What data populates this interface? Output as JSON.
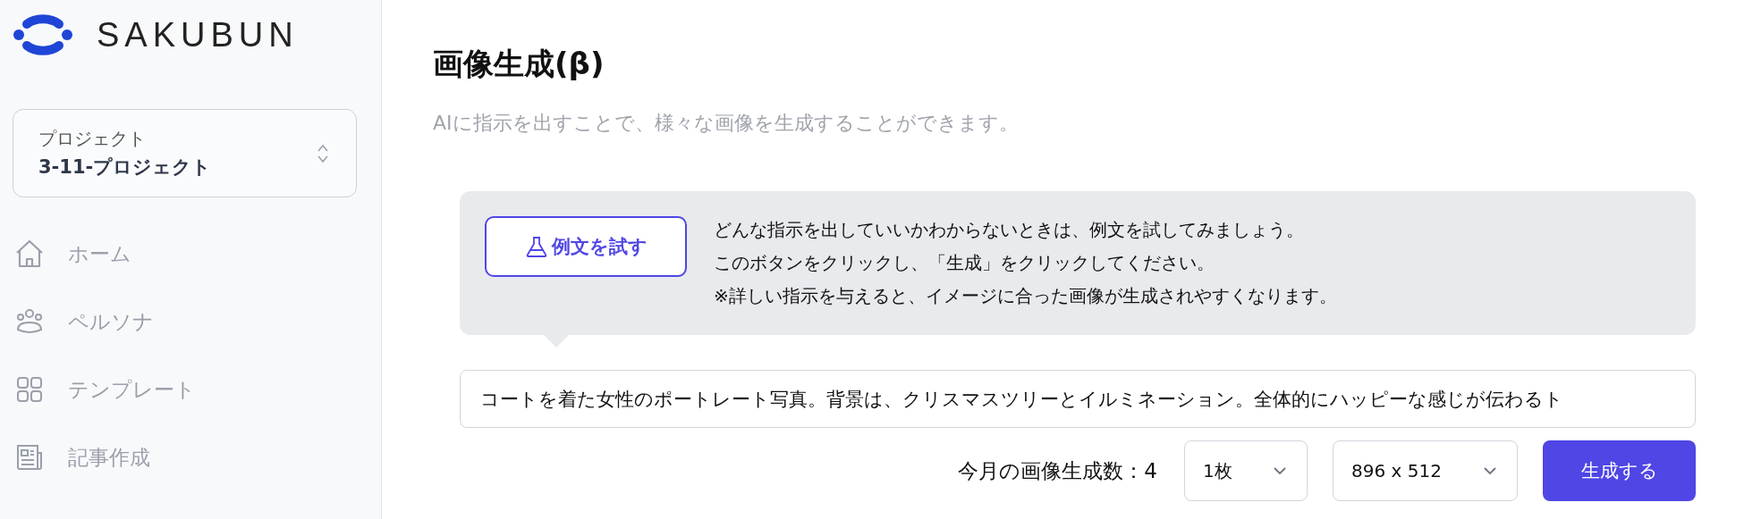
{
  "brand": "SAKUBUN",
  "project": {
    "label": "プロジェクト",
    "value": "3-11-プロジェクト"
  },
  "nav": [
    {
      "label": "ホーム",
      "kind": "home",
      "selected": false
    },
    {
      "label": "ペルソナ",
      "kind": "people",
      "selected": false
    },
    {
      "label": "テンプレート",
      "kind": "grid",
      "selected": false
    },
    {
      "label": "記事作成",
      "kind": "article",
      "selected": false
    }
  ],
  "page": {
    "title": "画像生成(β)",
    "subtitle": "AIに指示を出すことで、様々な画像を生成することができます。"
  },
  "tip": {
    "button": "例文を試す",
    "lines": [
      "どんな指示を出していいかわからないときは、例文を試してみましょう。",
      "このボタンをクリックし、「生成」をクリックしてください。",
      "※詳しい指示を与えると、イメージに合った画像が生成されやすくなります。"
    ]
  },
  "prompt": {
    "value": "コートを着た女性のポートレート写真。背景は、クリスマスツリーとイルミネーション。全体的にハッピーな感じが伝わるト"
  },
  "usage": "今月の画像生成数：4",
  "count_select": "1枚",
  "size_select": "896 x 512",
  "generate_button": "生成する"
}
